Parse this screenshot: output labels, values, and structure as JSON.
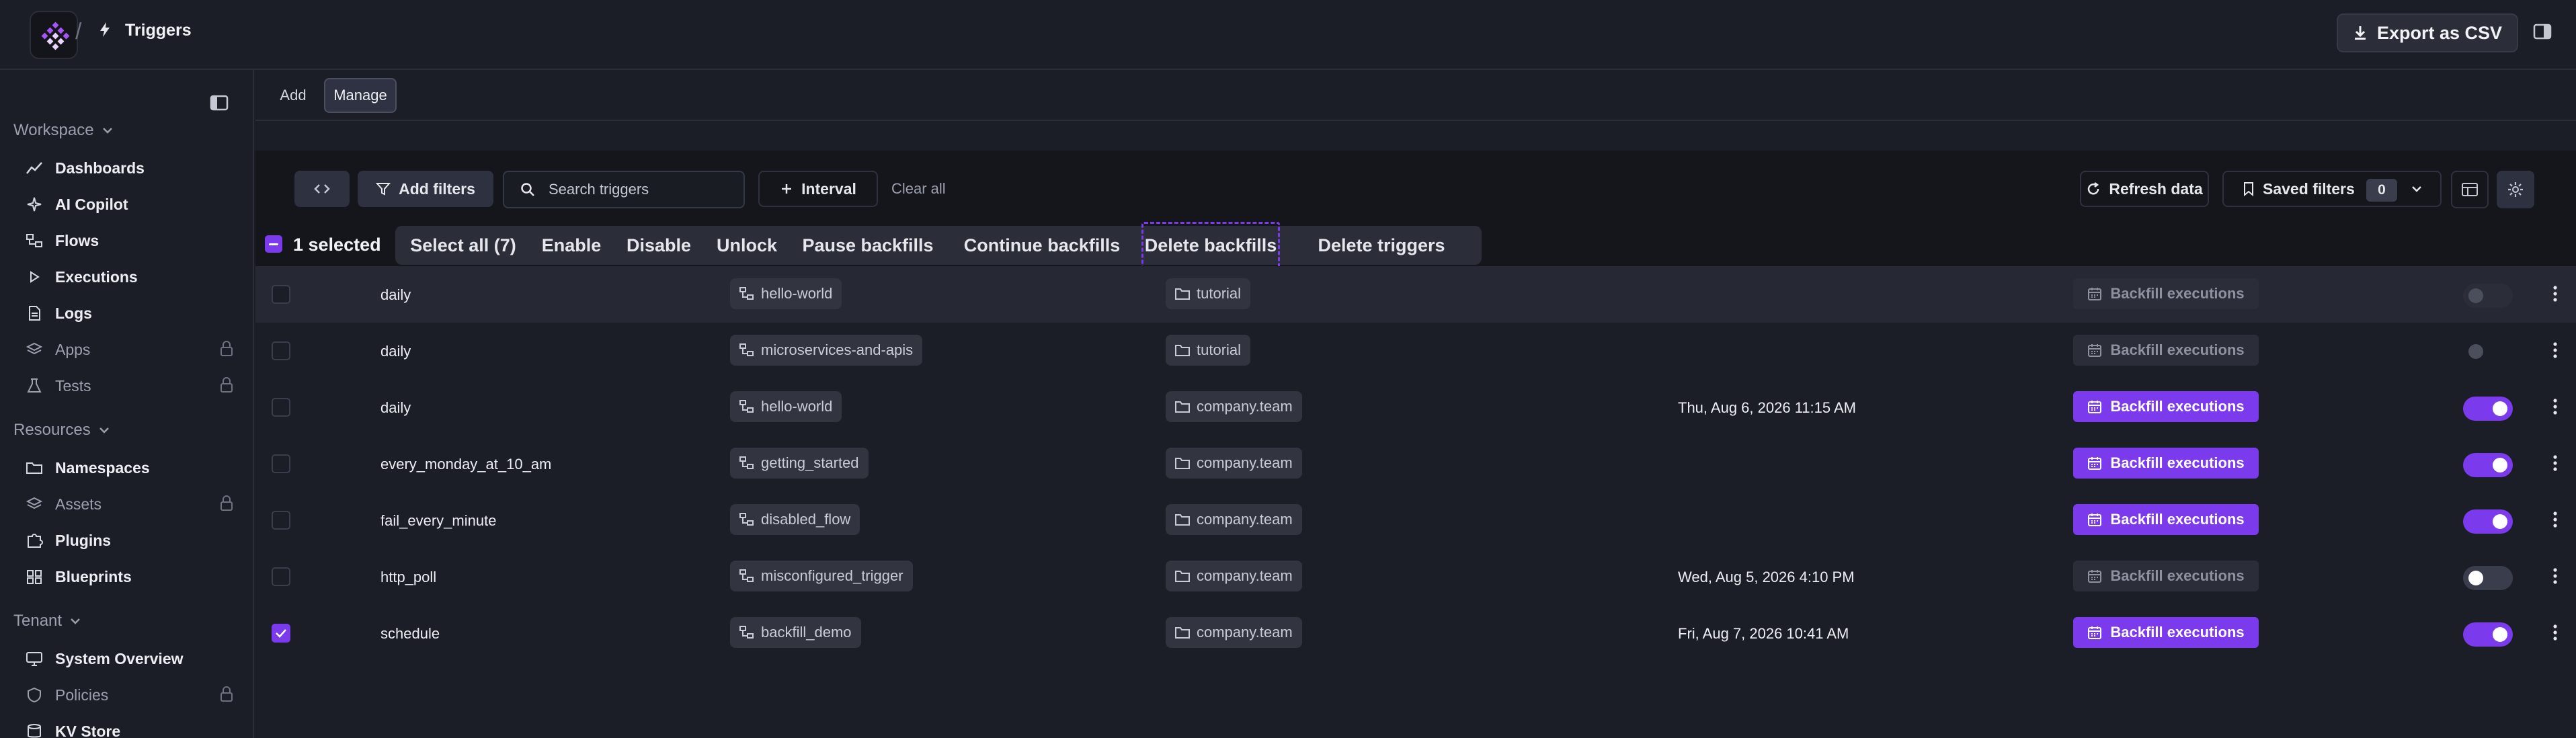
{
  "topbar": {
    "separator": "/",
    "title": "Triggers",
    "export_label": "Export as CSV"
  },
  "sidebar": {
    "workspace_label": "Workspace",
    "workspace_items": [
      {
        "label": "Dashboards",
        "icon": "chart-line-icon",
        "locked": false
      },
      {
        "label": "AI Copilot",
        "icon": "sparkle-icon",
        "locked": false
      },
      {
        "label": "Flows",
        "icon": "flow-icon",
        "locked": false
      },
      {
        "label": "Executions",
        "icon": "play-icon",
        "locked": false
      },
      {
        "label": "Logs",
        "icon": "file-text-icon",
        "locked": false
      },
      {
        "label": "Apps",
        "icon": "layers-icon",
        "locked": true
      },
      {
        "label": "Tests",
        "icon": "flask-icon",
        "locked": true
      }
    ],
    "resources_label": "Resources",
    "resources_items": [
      {
        "label": "Namespaces",
        "icon": "folder-icon",
        "locked": false
      },
      {
        "label": "Assets",
        "icon": "layers-icon",
        "locked": true
      },
      {
        "label": "Plugins",
        "icon": "puzzle-icon",
        "locked": false
      },
      {
        "label": "Blueprints",
        "icon": "grid-icon",
        "locked": false
      }
    ],
    "tenant_label": "Tenant",
    "tenant_items": [
      {
        "label": "System Overview",
        "icon": "monitor-icon",
        "locked": false
      },
      {
        "label": "Policies",
        "icon": "shield-icon",
        "locked": true
      },
      {
        "label": "KV Store",
        "icon": "database-icon",
        "locked": false
      }
    ]
  },
  "tabs": {
    "add": "Add",
    "manage": "Manage",
    "active": "manage"
  },
  "filters": {
    "add_filters": "Add filters",
    "search_placeholder": "Search triggers",
    "interval": "Interval",
    "clear_all": "Clear all",
    "refresh": "Refresh data",
    "saved_filters": "Saved filters",
    "saved_count": "0"
  },
  "bulk": {
    "selected_text": "1 selected",
    "actions": [
      "Select all (7)",
      "Enable",
      "Disable",
      "Unlock",
      "Pause backfills",
      "Continue backfills",
      "Delete backfills",
      "Delete triggers"
    ],
    "focused": "Delete backfills"
  },
  "backfill_label": "Backfill executions",
  "rows": [
    {
      "name": "daily",
      "flow": "hello-world",
      "namespace": "tutorial",
      "next_date": "",
      "backfill_enabled": false,
      "toggle": "disabled",
      "checked": false
    },
    {
      "name": "daily",
      "flow": "microservices-and-apis",
      "namespace": "tutorial",
      "next_date": "",
      "backfill_enabled": false,
      "toggle": "dot",
      "checked": false
    },
    {
      "name": "daily",
      "flow": "hello-world",
      "namespace": "company.team",
      "next_date": "Thu, Aug 6, 2026 11:15 AM",
      "backfill_enabled": true,
      "toggle": "on",
      "checked": false
    },
    {
      "name": "every_monday_at_10_am",
      "flow": "getting_started",
      "namespace": "company.team",
      "next_date": "",
      "backfill_enabled": true,
      "toggle": "on",
      "checked": false
    },
    {
      "name": "fail_every_minute",
      "flow": "disabled_flow",
      "namespace": "company.team",
      "next_date": "",
      "backfill_enabled": true,
      "toggle": "on",
      "checked": false
    },
    {
      "name": "http_poll",
      "flow": "misconfigured_trigger",
      "namespace": "company.team",
      "next_date": "Wed, Aug 5, 2026 4:10 PM",
      "backfill_enabled": false,
      "toggle": "off",
      "checked": false
    },
    {
      "name": "schedule",
      "flow": "backfill_demo",
      "namespace": "company.team",
      "next_date": "Fri, Aug 7, 2026 10:41 AM",
      "backfill_enabled": true,
      "toggle": "on",
      "checked": true
    }
  ],
  "colors": {
    "accent": "#7c3aed",
    "background": "#1c1e27",
    "panel": "#15161c"
  }
}
